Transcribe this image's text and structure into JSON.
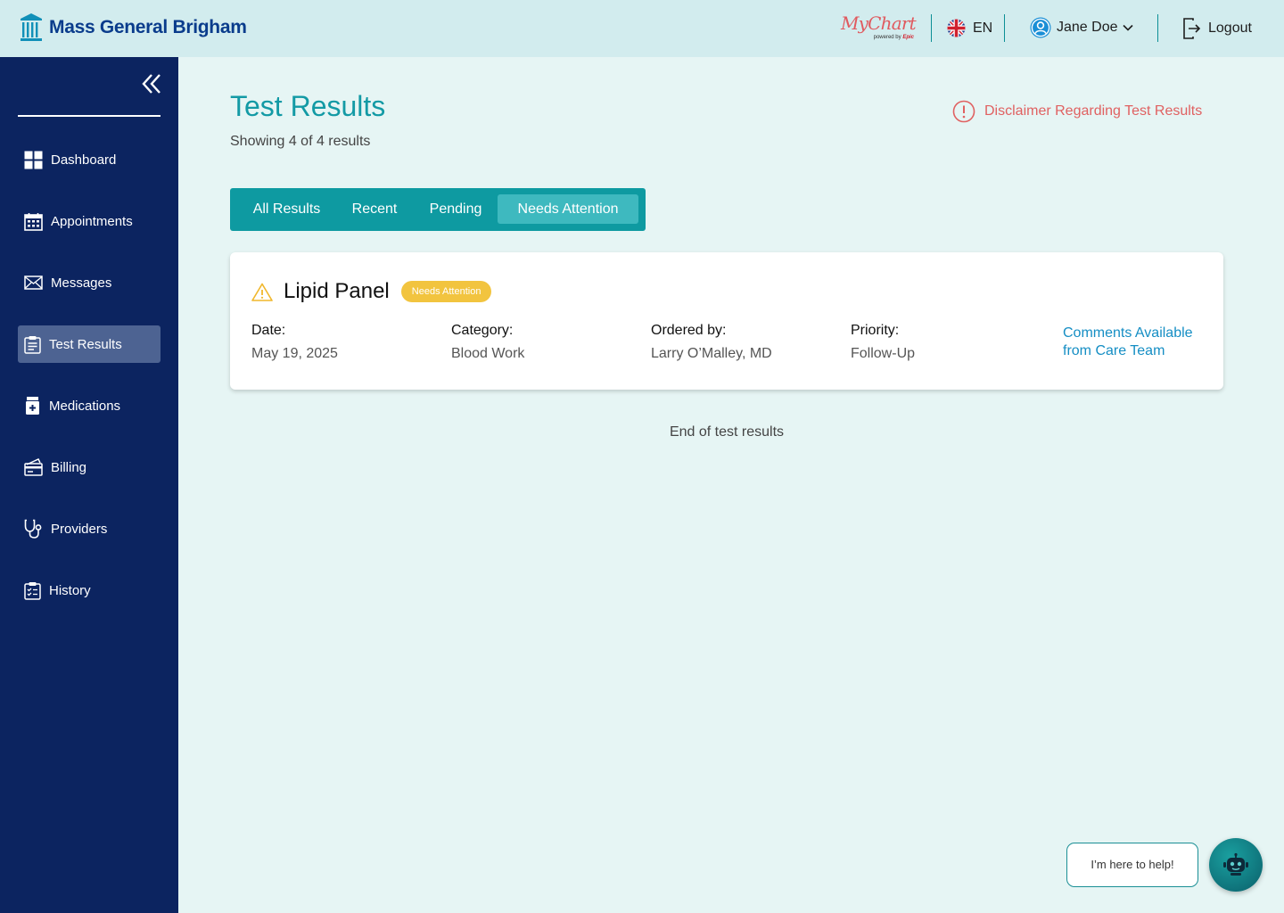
{
  "header": {
    "brand_name": "Mass General Brigham",
    "mychart": {
      "title": "MyChart",
      "powered_by": "powered by",
      "epic": "Epic"
    },
    "language": "EN",
    "user_name": "Jane Doe",
    "logout_label": "Logout"
  },
  "sidebar": {
    "items": [
      {
        "label": "Dashboard",
        "icon": "dashboard-icon"
      },
      {
        "label": "Appointments",
        "icon": "calendar-icon"
      },
      {
        "label": "Messages",
        "icon": "envelope-icon"
      },
      {
        "label": "Test Results",
        "icon": "clipboard-icon",
        "active": true
      },
      {
        "label": "Medications",
        "icon": "medicine-bottle-icon"
      },
      {
        "label": "Billing",
        "icon": "billing-icon"
      },
      {
        "label": "Providers",
        "icon": "stethoscope-icon"
      },
      {
        "label": "History",
        "icon": "clipboard-list-icon"
      }
    ]
  },
  "main": {
    "title": "Test Results",
    "subtitle": "Showing 4 of 4 results",
    "disclaimer": "Disclaimer Regarding Test Results",
    "tabs": [
      {
        "label": "All Results"
      },
      {
        "label": "Recent"
      },
      {
        "label": "Pending"
      },
      {
        "label": "Needs Attention",
        "active": true
      }
    ],
    "result": {
      "title": "Lipid Panel",
      "badge": "Needs Attention",
      "fields": [
        {
          "label": "Date:",
          "value": "May 19, 2025"
        },
        {
          "label": "Category:",
          "value": "Blood Work"
        },
        {
          "label": "Ordered by:",
          "value": "Larry O’Malley, MD"
        },
        {
          "label": "Priority:",
          "value": "Follow-Up"
        }
      ],
      "comments": "Comments Available from Care Team"
    },
    "end_text": "End of test results"
  },
  "help": {
    "bubble": "I’m here to help!"
  },
  "colors": {
    "sidebar_bg": "#0c2460",
    "topbar_bg": "#d2ecee",
    "page_bg": "#e6f5f4",
    "accent_teal": "#0e9aa1",
    "title_teal": "#139aa5",
    "badge_yellow": "#f2c43f",
    "warning_red": "#e06161",
    "link_blue": "#158ec4"
  }
}
